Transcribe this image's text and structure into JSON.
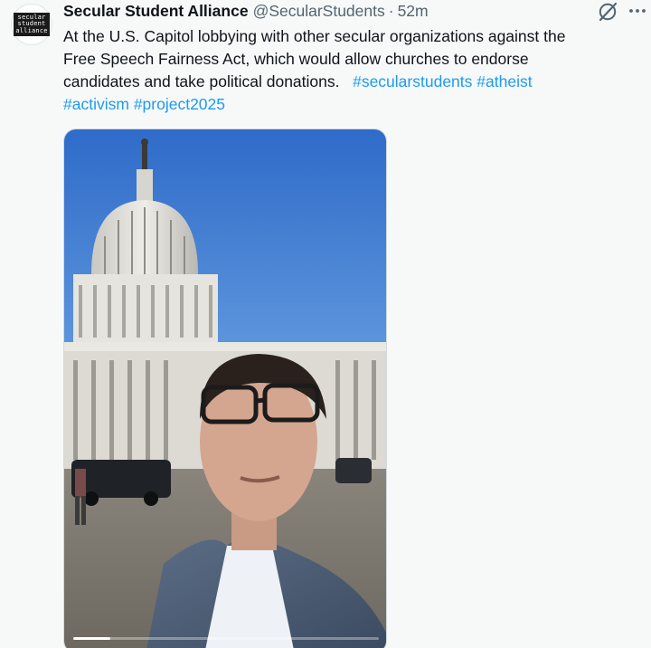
{
  "author": {
    "avatar_lines": [
      "secular",
      "student",
      "alliance"
    ],
    "display_name": "Secular Student Alliance",
    "handle": "@SecularStudents",
    "separator": "·",
    "timestamp": "52m"
  },
  "tweet": {
    "line1": "At the U.S. Capitol lobbying with other secular organizations against the",
    "line2": "Free Speech Fairness Act, which would allow churches to endorse",
    "line3_text": "candidates and take political donations.",
    "hashtags": [
      "#secularstudents",
      "#atheist",
      "#activism",
      "#project2025"
    ]
  },
  "media": {
    "type": "video",
    "subject": "man in glasses in front of U.S. Capitol dome",
    "progress": 0.12
  },
  "icons": {
    "grok": "grok-icon",
    "more": "more-icon"
  },
  "colors": {
    "accent": "#1d9bf0",
    "text": "#0f1419",
    "muted": "#536471",
    "background": "#f7f9f9"
  }
}
